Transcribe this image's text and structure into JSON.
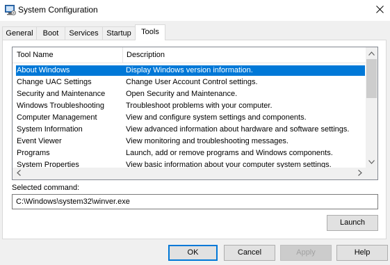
{
  "window": {
    "title": "System Configuration",
    "close_glyph": "✕"
  },
  "tabs": [
    {
      "label": "General"
    },
    {
      "label": "Boot"
    },
    {
      "label": "Services"
    },
    {
      "label": "Startup"
    },
    {
      "label": "Tools",
      "active": true
    }
  ],
  "tools_list": {
    "columns": [
      "Tool Name",
      "Description"
    ],
    "selected_index": 0,
    "rows": [
      {
        "name": "About Windows",
        "description": "Display Windows version information."
      },
      {
        "name": "Change UAC Settings",
        "description": "Change User Account Control settings."
      },
      {
        "name": "Security and Maintenance",
        "description": "Open Security and Maintenance."
      },
      {
        "name": "Windows Troubleshooting",
        "description": "Troubleshoot problems with your computer."
      },
      {
        "name": "Computer Management",
        "description": "View and configure system settings and components."
      },
      {
        "name": "System Information",
        "description": "View advanced information about hardware and software settings."
      },
      {
        "name": "Event Viewer",
        "description": "View monitoring and troubleshooting messages."
      },
      {
        "name": "Programs",
        "description": "Launch, add or remove programs and Windows components."
      },
      {
        "name": "System Properties",
        "description": "View basic information about your computer system settings."
      }
    ]
  },
  "selected_command": {
    "label": "Selected command:",
    "value": "C:\\Windows\\system32\\winver.exe"
  },
  "buttons": {
    "launch": "Launch",
    "ok": "OK",
    "cancel": "Cancel",
    "apply": "Apply",
    "help": "Help"
  },
  "colors": {
    "selection": "#0078d7",
    "window_bg": "#f0f0f0",
    "panel_bg": "#ffffff"
  }
}
